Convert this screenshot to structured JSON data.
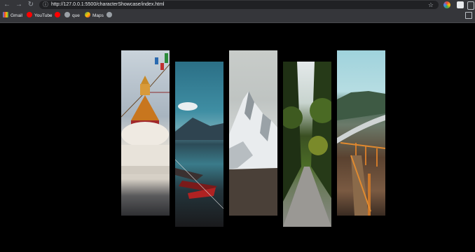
{
  "browser": {
    "url": "http://127.0.0.1:5500/characterShowcase/index.html",
    "bookmarks": [
      {
        "label": "Gmail",
        "icon": "gmail-icon"
      },
      {
        "label": "YouTube",
        "icon": "youtube-icon"
      },
      {
        "label": "",
        "icon": "youtube-icon"
      },
      {
        "label": "que",
        "icon": "globe-icon"
      },
      {
        "label": "Maps",
        "icon": "maps-icon"
      },
      {
        "label": "",
        "icon": "globe-icon"
      }
    ]
  },
  "gallery": {
    "panels": [
      {
        "subject": "stupa with prayer flags"
      },
      {
        "subject": "lake with red boats"
      },
      {
        "subject": "snowy mountain peak"
      },
      {
        "subject": "forest road"
      },
      {
        "subject": "mountain road with wooden fence"
      }
    ]
  }
}
